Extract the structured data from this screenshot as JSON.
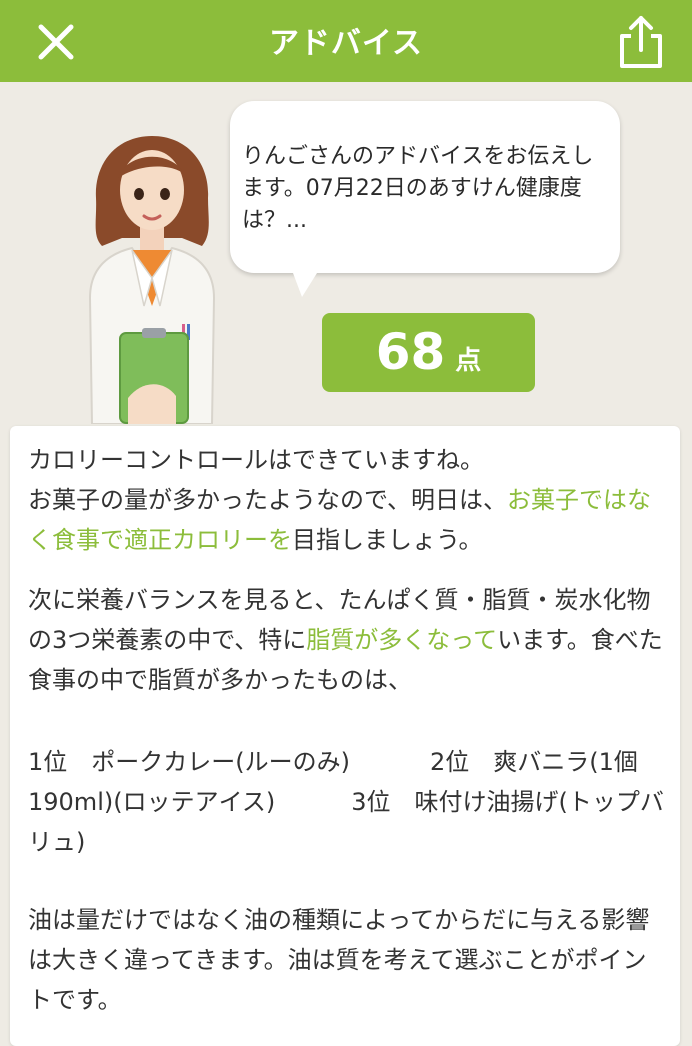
{
  "header": {
    "title": "アドバイス",
    "close_icon": "close-icon",
    "share_icon": "share-icon"
  },
  "bubble": {
    "text": "りんごさんのアドバイスをお伝えします。07月22日のあすけん健康度は？..."
  },
  "score": {
    "value": "68",
    "unit": "点"
  },
  "advice": {
    "p1_a": "カロリーコントロールはできていますね。",
    "p1_b": "お菓子の量が多かったようなので、明日は、",
    "p1_hl": "お菓子ではなく食事で適正カロリーを",
    "p1_c": "目指しましょう。",
    "p2_a": "次に栄養バランスを見ると、たんぱく質・脂質・炭水化物の3つ栄養素の中で、特に",
    "p2_hl": "脂質が多くなって",
    "p2_b": "います。食べた食事の中で脂質が多かったものは、",
    "rank1": "1位　ポークカレー(ルーのみ)",
    "rank2": "2位　爽バニラ(1個190ml)(ロッテアイス)",
    "rank3": "3位　味付け油揚げ(トップバリュ)",
    "p4": "油は量だけではなく油の種類によってからだに与える影響は大きく違ってきます。油は質を考えて選ぶことがポイントです。"
  },
  "colors": {
    "brand_green": "#8cbd3b",
    "background": "#eeebe4"
  }
}
